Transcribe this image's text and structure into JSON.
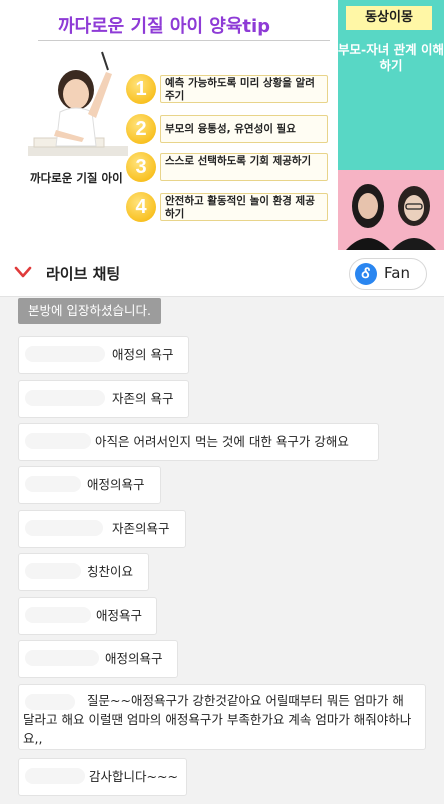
{
  "video": {
    "slide_title": "까다로운 기질 아이 양육tip",
    "girl_caption": "까다로운 기질 아이",
    "tips": [
      {
        "num": "1",
        "text": "예측 가능하도록 미리 상황을 알려주기"
      },
      {
        "num": "2",
        "text": "부모의 융통성, 유연성이 필요"
      },
      {
        "num": "3",
        "text": "스스로 선택하도록 기회 제공하기"
      },
      {
        "num": "4",
        "text": "안전하고 활동적인 놀이 환경 제공하기"
      }
    ],
    "badge": "동상이몽",
    "side_text": "부모-자녀 관계 이해하기"
  },
  "chat_header": {
    "title": "라이브 채팅",
    "fan_icon": "Ꮄ",
    "fan_label": "Fan"
  },
  "chat": {
    "system_message": "본방에 입장하셨습니다.",
    "messages": [
      {
        "text": "애정의 욕구"
      },
      {
        "text": "자존의 욕구"
      },
      {
        "text": "아직은 어려서인지 먹는 것에 대한 욕구가 강해요"
      },
      {
        "text": "애정의욕구"
      },
      {
        "text": "자존의욕구"
      },
      {
        "text": "칭찬이요"
      },
      {
        "text": "애정욕구"
      },
      {
        "text": "애정의욕구"
      },
      {
        "text": "질문~~애정욕구가 강한것같아요 어릴때부터 뭐든 엄마가 해달라고 해요  이럴땐  엄마의 애정욕구가 부족한가요 계속 엄마가 해줘야하나요,,"
      },
      {
        "text": "감사합니다~~~"
      }
    ]
  },
  "colors": {
    "title_purple": "#8e3bd6",
    "side_teal": "#58d7c5",
    "badge_yellow": "#fff7a6",
    "fan_blue": "#2a86f0",
    "chevron_red": "#e03b3b"
  }
}
